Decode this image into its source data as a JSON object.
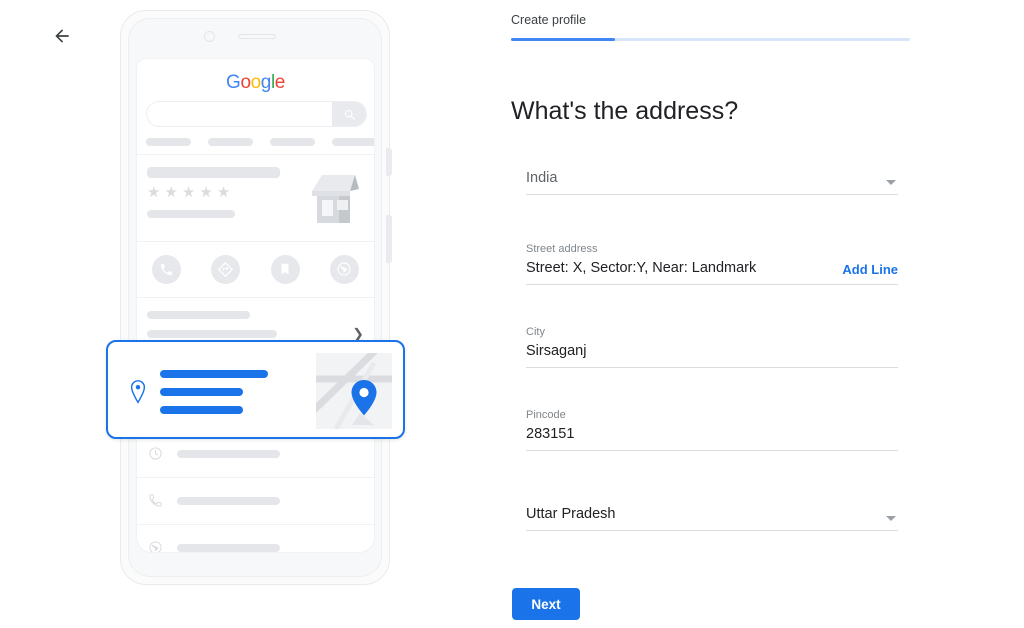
{
  "nav": {
    "back_icon": "arrow-left-icon"
  },
  "wizard": {
    "tab_label": "Create profile",
    "progress_percent": 26,
    "accent_color": "#4285f4",
    "track_color": "#d7e5fb"
  },
  "form": {
    "title": "What's the address?",
    "country": {
      "label": "",
      "value": "India",
      "caret_icon": "chevron-down-icon"
    },
    "street": {
      "label": "Street address",
      "value": "Street: X, Sector:Y, Near: Landmark",
      "add_line_label": "Add Line",
      "link_color": "#1a73e8"
    },
    "city": {
      "label": "City",
      "value": "Sirsaganj"
    },
    "pincode": {
      "label": "Pincode",
      "value": "283151"
    },
    "state": {
      "label": "",
      "value": "Uttar Pradesh",
      "caret_icon": "chevron-down-icon"
    },
    "submit_label": "Next",
    "submit_color": "#1a73e8"
  },
  "illustration": {
    "device": "android-phone-mockup",
    "brand": {
      "letters": [
        "G",
        "o",
        "o",
        "g",
        "l",
        "e"
      ],
      "colors": [
        "#4285f4",
        "#ea4335",
        "#fbbc05",
        "#4285f4",
        "#34a853",
        "#ea4335"
      ]
    },
    "search": {
      "placeholder": "",
      "icon": "search-icon"
    },
    "listing": {
      "rating_stars": 5,
      "star_glyph": "★",
      "thumbnail": "storefront-illustration",
      "actions": [
        "call-icon",
        "directions-icon",
        "save-icon",
        "website-icon"
      ]
    },
    "highlight_card": {
      "icon": "location-pin-icon",
      "thumbnail": "map-thumbnail",
      "border_color": "#1a73e8",
      "bar_color": "#1a73e8"
    },
    "detail_rows": [
      "clock-icon",
      "phone-icon",
      "globe-icon"
    ]
  }
}
